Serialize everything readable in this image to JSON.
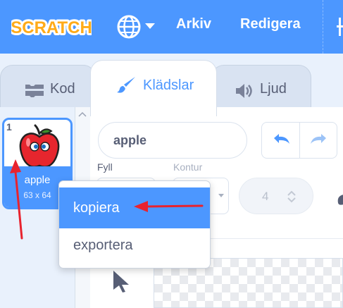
{
  "menubar": {
    "logo_text": "SCRATCH",
    "language_icon": "globe-icon",
    "items": [
      "Arkiv",
      "Redigera"
    ]
  },
  "tabs": [
    {
      "label": "Kod",
      "icon": "code-blocks-icon",
      "active": false
    },
    {
      "label": "Klädslar",
      "icon": "paintbrush-icon",
      "active": true
    },
    {
      "label": "Ljud",
      "icon": "speaker-icon",
      "active": false
    }
  ],
  "costume": {
    "number": "1",
    "name": "apple",
    "size": "63 x 64"
  },
  "editor": {
    "costume_name": "apple",
    "fill_label": "Fyll",
    "outline_label": "Kontur",
    "outline_width": "4"
  },
  "context_menu": {
    "items": [
      "kopiera",
      "exportera"
    ],
    "highlighted": "kopiera"
  },
  "colors": {
    "accent": "#4c97ff",
    "annotation": "#e8232e",
    "text": "#575e75"
  }
}
